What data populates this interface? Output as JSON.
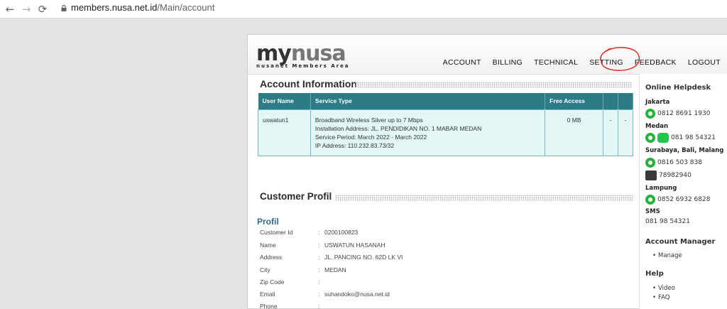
{
  "browser": {
    "back_glyph": "←",
    "forward_glyph": "→",
    "reload_glyph": "⟳",
    "url_host": "members.nusa.net.id",
    "url_path": "/Main/account"
  },
  "header": {
    "logo_my": "my",
    "logo_nusa": "nusa",
    "logo_sub": "nusanet Members Area",
    "nav": [
      "ACCOUNT",
      "BILLING",
      "TECHNICAL",
      "SETTING",
      "FEEDBACK",
      "LOGOUT"
    ]
  },
  "account": {
    "title": "Account Information",
    "columns": [
      "User Name",
      "Service Type",
      "Free Access",
      "",
      ""
    ],
    "row": {
      "username": "uswatun1",
      "service_lines": [
        "Broadband Wireless Silver up to 7 Mbps",
        "Installation Address: JL. PENDIDIKAN NO. 1 MABAR MEDAN",
        "Service Period: March 2022 - March 2022",
        "IP Address: 110.232.83.73/32"
      ],
      "free_access": "0 MB",
      "col4": "-",
      "col5": "-"
    }
  },
  "profile": {
    "section_title": "Customer Profil",
    "heading": "Profil",
    "rows": [
      {
        "label": "Customer Id",
        "sep": ":",
        "value": "0200100823"
      },
      {
        "label": "Name",
        "sep": ":",
        "value": "USWATUN HASANAH"
      },
      {
        "label": "Address",
        "sep": ":",
        "value": "JL. PANCING NO. 62D LK VI"
      },
      {
        "label": "City",
        "sep": ":",
        "value": "MEDAN"
      },
      {
        "label": "Zip Code",
        "sep": ":",
        "value": ""
      },
      {
        "label": "Email",
        "sep": ":",
        "value": "suhandoko@nusa.net.id"
      },
      {
        "label": "Phone",
        "sep": ":",
        "value": ""
      }
    ]
  },
  "sidebar": {
    "helpdesk_title": "Online Helpdesk",
    "jakarta": "Jakarta",
    "jakarta_phone": "0812 8691 1930",
    "medan": "Medan",
    "medan_phone": "081 98 54321",
    "surabaya": "Surabaya, Bali, Malang",
    "surabaya_phone": "0816 503 838",
    "surabaya_bbm": "78982940",
    "lampung": "Lampung",
    "lampung_phone": "0852 6932 6828",
    "sms": "SMS",
    "sms_phone": "081 98 54321",
    "account_manager_title": "Account Manager",
    "manage": "Manage",
    "help_title": "Help",
    "video": "Video",
    "faq": "FAQ"
  }
}
